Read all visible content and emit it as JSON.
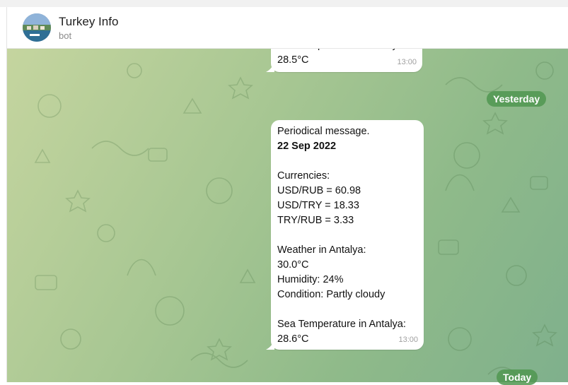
{
  "header": {
    "title": "Turkey Info",
    "subtitle": "bot"
  },
  "messages": [
    {
      "lines": [
        "Sea Temperature in Antalya:",
        "28.5°C"
      ],
      "time": "13:00"
    },
    {
      "line1": "Periodical message.",
      "line2": "22 Sep 2022",
      "currencies_title": "Currencies:",
      "usd_rub": "USD/RUB = 60.98",
      "usd_try": "USD/TRY = 18.33",
      "try_rub": "TRY/RUB = 3.33",
      "weather_title": "Weather in Antalya:",
      "temp": "30.0°C",
      "humidity": "Humidity: 24%",
      "condition": "Condition: Partly cloudy",
      "sea_title": "Sea Temperature in Antalya:",
      "sea_temp": "28.6°C",
      "time": "13:00"
    }
  ],
  "date_separators": {
    "yesterday": "Yesterday",
    "today": "Today"
  },
  "colors": {
    "date_pill": "#5a9a5a",
    "bubble": "#ffffff"
  }
}
